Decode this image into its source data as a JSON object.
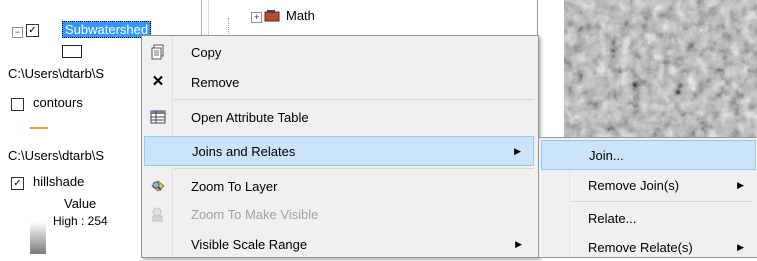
{
  "toc": {
    "layer1": {
      "name": "Subwatershed",
      "checked": "✓",
      "expander": "−"
    },
    "path1": "C:\\Users\\dtarb\\S",
    "layer2": {
      "name": "contours",
      "checked": ""
    },
    "path2": "C:\\Users\\dtarb\\S",
    "layer3": {
      "name": "hillshade",
      "checked": "✓"
    },
    "legend": {
      "title": "Value",
      "high": "High : 254"
    }
  },
  "catalog": {
    "item": "Math",
    "expander": "+"
  },
  "context_menu": {
    "items": [
      {
        "label": "Copy",
        "icon": "copy-icon",
        "glyph": "📄"
      },
      {
        "label": "Remove",
        "icon": "remove-icon",
        "glyph": "✕"
      },
      {
        "label": "Open Attribute Table",
        "icon": "table-icon",
        "glyph": "▦"
      },
      {
        "label": "Joins and Relates",
        "icon": "",
        "glyph": "",
        "arrow": "▶"
      },
      {
        "label": "Zoom To Layer",
        "icon": "zoom-to-layer-icon",
        "glyph": "◈"
      },
      {
        "label": "Zoom To Make Visible",
        "icon": "zoom-visible-icon",
        "glyph": "◈"
      },
      {
        "label": "Visible Scale Range",
        "icon": "",
        "glyph": "",
        "arrow": "▶"
      }
    ]
  },
  "submenu": {
    "items": [
      {
        "label": "Join...",
        "arrow": ""
      },
      {
        "label": "Remove Join(s)",
        "arrow": "▶"
      },
      {
        "label": "Relate...",
        "arrow": ""
      },
      {
        "label": "Remove Relate(s)",
        "arrow": "▶"
      }
    ]
  },
  "colors": {
    "selection": "#3399ff",
    "menu_highlight": "#cce4fa",
    "contour_swatch": "#e8a14a"
  }
}
